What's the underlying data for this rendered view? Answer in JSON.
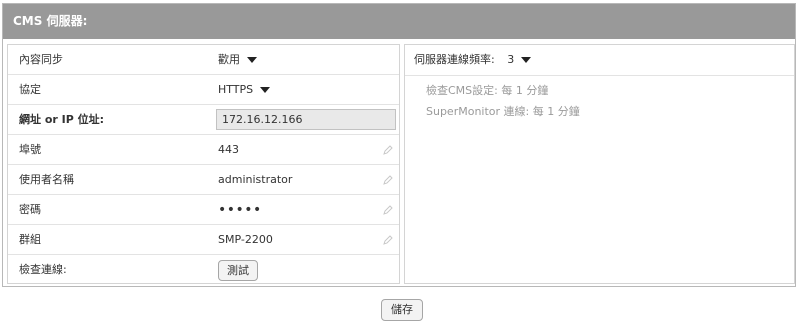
{
  "panel": {
    "title": "CMS 伺服器:"
  },
  "settings": {
    "content_sync": {
      "label": "內容同步",
      "value": "歡用"
    },
    "protocol": {
      "label": "協定",
      "value": "HTTPS"
    },
    "address": {
      "label": "網址 or IP 位址:",
      "value": "172.16.12.166"
    },
    "port": {
      "label": "埠號",
      "value": "443"
    },
    "username": {
      "label": "使用者名稱",
      "value": "administrator"
    },
    "password": {
      "label": "密碼",
      "value": "•••••"
    },
    "group": {
      "label": "群組",
      "value": "SMP-2200"
    },
    "check_connection": {
      "label": "檢查連線:",
      "button_label": "測試"
    }
  },
  "right": {
    "frequency": {
      "label": "伺服器連線頻率:",
      "value": "3"
    },
    "info": [
      "檢查CMS設定: 每 1 分鐘",
      "SuperMonitor 連線: 每 1 分鐘"
    ]
  },
  "footer": {
    "save_label": "儲存"
  },
  "colors": {
    "header_bg": "#999999",
    "header_text": "#ffffff",
    "input_bg": "#e9e9e9",
    "info_text": "#9a9a9a"
  }
}
